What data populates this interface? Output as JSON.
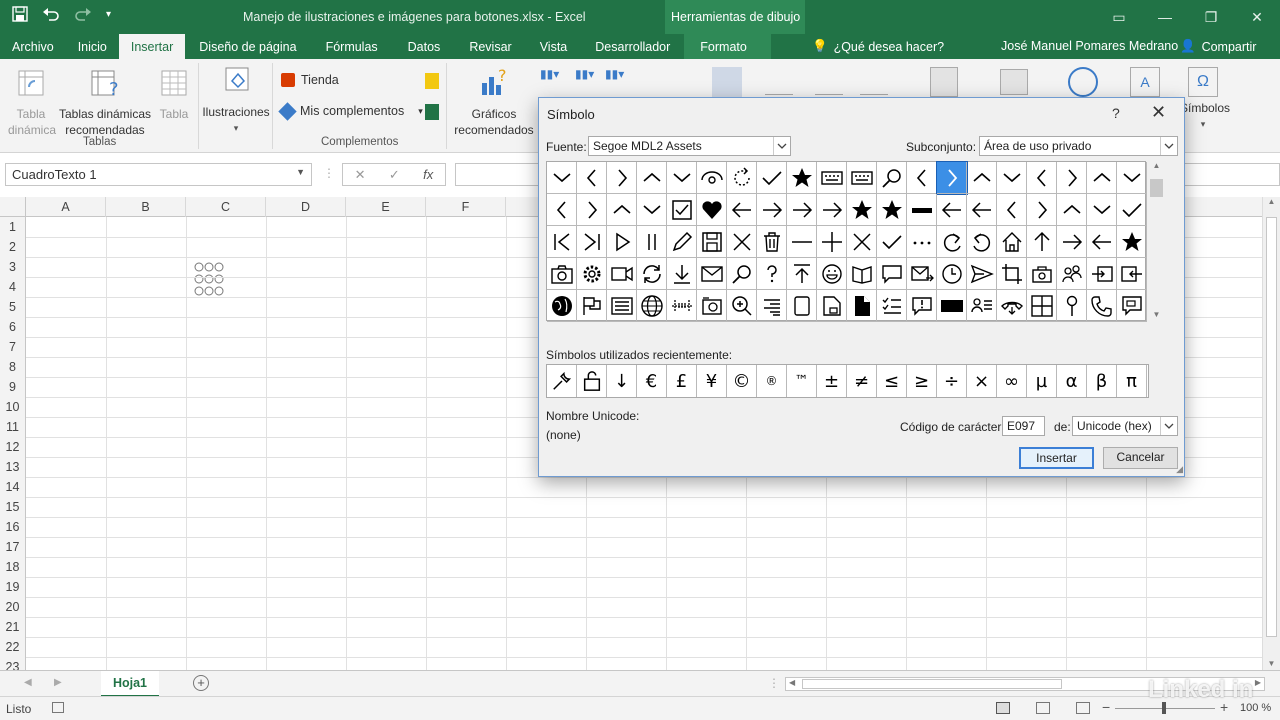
{
  "app": {
    "doc_title": "Manejo de ilustraciones e imágenes para botones.xlsx - Excel",
    "context_title": "Herramientas de dibujo",
    "user": "José Manuel Pomares Medrano",
    "share": "Compartir",
    "tell_me": "¿Qué desea hacer?"
  },
  "tabs": [
    "Archivo",
    "Inicio",
    "Insertar",
    "Diseño de página",
    "Fórmulas",
    "Datos",
    "Revisar",
    "Vista",
    "Desarrollador",
    "Formato"
  ],
  "ribbon": {
    "tabla_dinamica": "Tabla dinámica",
    "tablas_dinamicas_rec": "Tablas dinámicas recomendadas",
    "tabla": "Tabla",
    "group_tablas": "Tablas",
    "ilustraciones": "Ilustraciones",
    "tienda": "Tienda",
    "mis_complementos": "Mis complementos",
    "group_complementos": "Complementos",
    "graficos_rec": "Gráficos recomendados",
    "simbolos": "Símbolos"
  },
  "formula": {
    "namebox": "CuadroTexto 1",
    "fx": "fx"
  },
  "columns": [
    "A",
    "B",
    "C",
    "D",
    "E",
    "F"
  ],
  "rows": [
    "1",
    "2",
    "3",
    "4",
    "5",
    "6",
    "7",
    "8",
    "9",
    "10",
    "11",
    "12",
    "13",
    "14",
    "15",
    "16",
    "17",
    "18",
    "19",
    "20",
    "21",
    "22",
    "23"
  ],
  "sheet": {
    "tab": "Hoja1"
  },
  "status": {
    "ready": "Listo",
    "zoom": "100 %"
  },
  "dialog": {
    "title": "Símbolo",
    "help": "?",
    "font_label": "Fuente:",
    "font_value": "Segoe MDL2 Assets",
    "subset_label": "Subconjunto:",
    "subset_value": "Área de uso privado",
    "recent_label": "Símbolos utilizados recientemente:",
    "recent": [
      "🔧",
      "🔓",
      "↓",
      "€",
      "£",
      "¥",
      "©",
      "®",
      "™",
      "±",
      "≠",
      "≤",
      "≥",
      "÷",
      "×",
      "∞",
      "µ",
      "α",
      "β",
      "π"
    ],
    "unicode_name_label": "Nombre Unicode:",
    "unicode_name_value": "(none)",
    "char_code_label": "Código de carácter:",
    "char_code_value": "E097",
    "from_label": "de:",
    "from_value": "Unicode (hex)",
    "insert": "Insertar",
    "cancel": "Cancelar"
  },
  "watermark": "Linked in"
}
